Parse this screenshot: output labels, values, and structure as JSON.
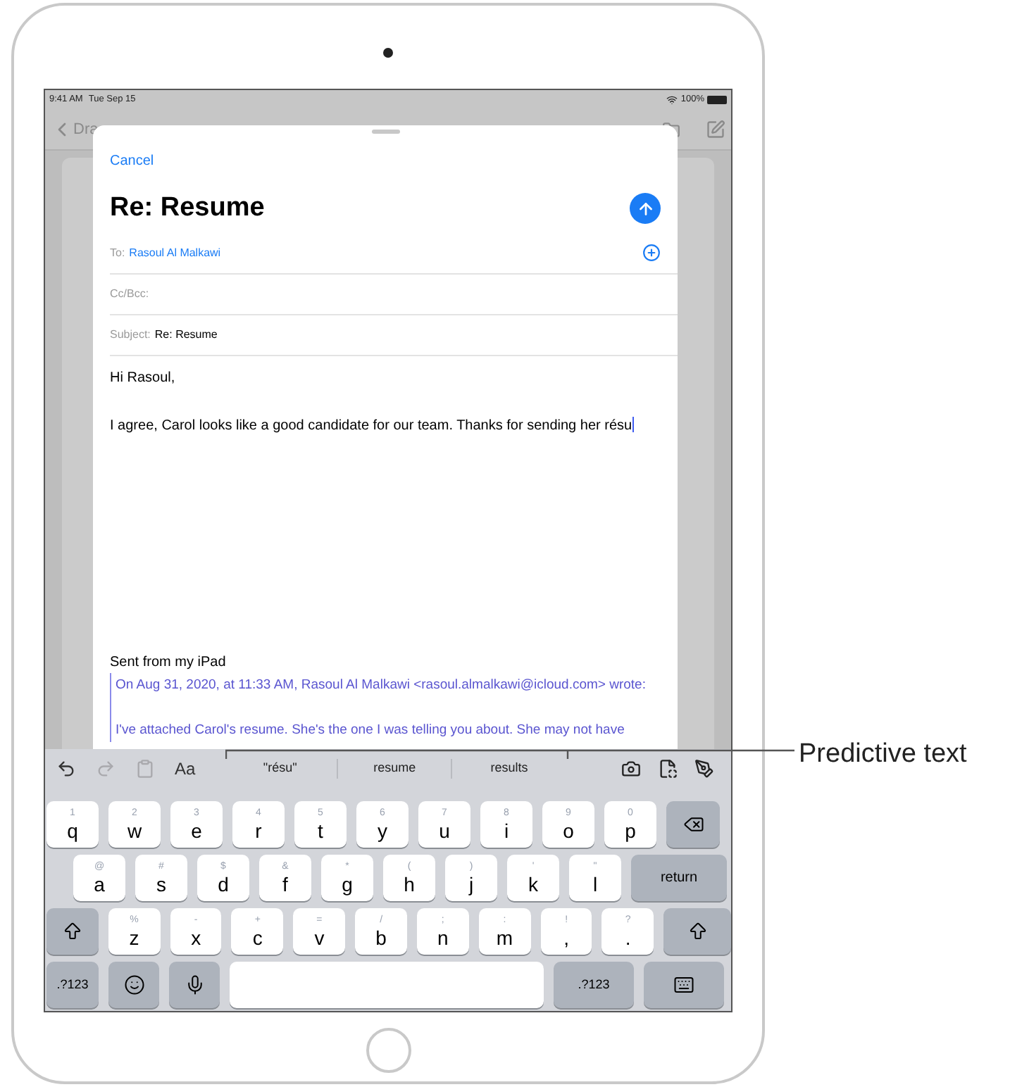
{
  "status_bar": {
    "time": "9:41 AM",
    "date": "Tue Sep 15",
    "battery": "100%"
  },
  "background_nav": {
    "back_label": "Dra"
  },
  "compose": {
    "cancel": "Cancel",
    "title": "Re: Resume",
    "fields": [
      {
        "kind": "recipient",
        "label": "To:",
        "value": "Rasoul Al Malkawi"
      },
      {
        "kind": "plain",
        "label": "Cc/Bcc:"
      },
      {
        "kind": "text",
        "label": "Subject:",
        "value": "Re: Resume"
      }
    ],
    "greeting": "Hi Rasoul,",
    "message": "I agree, Carol looks like a good candidate for our team. Thanks for sending her résu",
    "signature": "Sent from my iPad",
    "quote_header": "On Aug 31, 2020, at 11:33 AM, Rasoul Al Malkawi <rasoul.almalkawi@icloud.com> wrote:",
    "quote": "I've attached Carol's resume. She's the one I was telling you about. She may not have"
  },
  "shortcut_bar": {
    "left": [
      {
        "kind": "undo",
        "disabled": false
      },
      {
        "kind": "redo",
        "disabled": true
      },
      {
        "kind": "paste",
        "disabled": true
      }
    ],
    "format_label": "Aa",
    "predictions": [
      "\"résu\"",
      "resume",
      "results"
    ],
    "right": [
      {
        "kind": "camera"
      },
      {
        "kind": "scan"
      },
      {
        "kind": "markup"
      }
    ]
  },
  "keyboard": {
    "rows": [
      [
        {
          "kind": "letter",
          "hint": "1",
          "label": "q"
        },
        {
          "kind": "letter",
          "hint": "2",
          "label": "w"
        },
        {
          "kind": "letter",
          "hint": "3",
          "label": "e"
        },
        {
          "kind": "letter",
          "hint": "4",
          "label": "r"
        },
        {
          "kind": "letter",
          "hint": "5",
          "label": "t"
        },
        {
          "kind": "letter",
          "hint": "6",
          "label": "y"
        },
        {
          "kind": "letter",
          "hint": "7",
          "label": "u"
        },
        {
          "kind": "letter",
          "hint": "8",
          "label": "i"
        },
        {
          "kind": "letter",
          "hint": "9",
          "label": "o"
        },
        {
          "kind": "letter",
          "hint": "0",
          "label": "p"
        },
        {
          "kind": "delete"
        }
      ],
      [
        {
          "kind": "letter",
          "hint": "@",
          "label": "a"
        },
        {
          "kind": "letter",
          "hint": "#",
          "label": "s"
        },
        {
          "kind": "letter",
          "hint": "$",
          "label": "d"
        },
        {
          "kind": "letter",
          "hint": "&",
          "label": "f"
        },
        {
          "kind": "letter",
          "hint": "*",
          "label": "g"
        },
        {
          "kind": "letter",
          "hint": "(",
          "label": "h"
        },
        {
          "kind": "letter",
          "hint": ")",
          "label": "j"
        },
        {
          "kind": "letter",
          "hint": "'",
          "label": "k"
        },
        {
          "kind": "letter",
          "hint": "\"",
          "label": "l"
        },
        {
          "kind": "return",
          "label": "return"
        }
      ],
      [
        {
          "kind": "shift"
        },
        {
          "kind": "letter",
          "hint": "%",
          "label": "z"
        },
        {
          "kind": "letter",
          "hint": "-",
          "label": "x"
        },
        {
          "kind": "letter",
          "hint": "+",
          "label": "c"
        },
        {
          "kind": "letter",
          "hint": "=",
          "label": "v"
        },
        {
          "kind": "letter",
          "hint": "/",
          "label": "b"
        },
        {
          "kind": "letter",
          "hint": ";",
          "label": "n"
        },
        {
          "kind": "letter",
          "hint": ":",
          "label": "m"
        },
        {
          "kind": "letter",
          "hint": "!",
          "label": ","
        },
        {
          "kind": "letter",
          "hint": "?",
          "label": "."
        },
        {
          "kind": "shift"
        }
      ],
      [
        {
          "kind": "mode",
          "label": ".?123"
        },
        {
          "kind": "emoji"
        },
        {
          "kind": "dictation"
        },
        {
          "kind": "space"
        },
        {
          "kind": "mode",
          "label": ".?123"
        },
        {
          "kind": "hide"
        }
      ]
    ]
  },
  "callout": {
    "label": "Predictive text"
  }
}
